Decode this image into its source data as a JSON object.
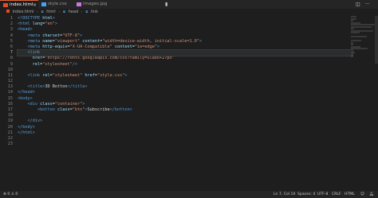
{
  "tabs": [
    {
      "label": "index.html",
      "icon": "html-file-icon",
      "active": true
    },
    {
      "label": "style.css",
      "icon": "css-file-icon",
      "active": false
    },
    {
      "label": "images.jpg",
      "icon": "image-file-icon",
      "active": false
    }
  ],
  "tab_close_glyph": "×",
  "breadcrumb": [
    {
      "label": "index.html"
    },
    {
      "label": "html"
    },
    {
      "label": "head"
    },
    {
      "label": "link"
    }
  ],
  "breadcrumb_sep": "›",
  "line_numbers": [
    "1",
    "2",
    "3",
    "4",
    "5",
    "6",
    "7",
    "8",
    "9",
    "10",
    "11",
    "12",
    "13",
    "14",
    "15",
    "16",
    "17",
    "18",
    "19",
    "20",
    "21",
    "22",
    "23"
  ],
  "current_line": 7,
  "code_lines": [
    [
      {
        "t": "<!DOCTYPE ",
        "c": "tag"
      },
      {
        "t": "html",
        "c": "attr"
      },
      {
        "t": ">",
        "c": "tag"
      }
    ],
    [
      {
        "t": "<html ",
        "c": "tag"
      },
      {
        "t": "lang",
        "c": "attr"
      },
      {
        "t": "=",
        "c": "txt"
      },
      {
        "t": "\"en\"",
        "c": "str"
      },
      {
        "t": ">",
        "c": "tag"
      }
    ],
    [
      {
        "t": "<head>",
        "c": "tag"
      }
    ],
    [
      {
        "t": "    "
      },
      {
        "t": "<meta ",
        "c": "tag"
      },
      {
        "t": "charset",
        "c": "attr"
      },
      {
        "t": "=",
        "c": "txt"
      },
      {
        "t": "\"UTF-8\"",
        "c": "str"
      },
      {
        "t": ">",
        "c": "tag"
      }
    ],
    [
      {
        "t": "    "
      },
      {
        "t": "<meta ",
        "c": "tag"
      },
      {
        "t": "name",
        "c": "attr"
      },
      {
        "t": "=",
        "c": "txt"
      },
      {
        "t": "\"viewport\"",
        "c": "str"
      },
      {
        "t": " "
      },
      {
        "t": "content",
        "c": "attr"
      },
      {
        "t": "=",
        "c": "txt"
      },
      {
        "t": "\"width=device-width, initial-scale=1.0\"",
        "c": "str"
      },
      {
        "t": ">",
        "c": "tag"
      }
    ],
    [
      {
        "t": "    "
      },
      {
        "t": "<meta ",
        "c": "tag"
      },
      {
        "t": "http-equiv",
        "c": "attr"
      },
      {
        "t": "=",
        "c": "txt"
      },
      {
        "t": "\"X-UA-Compatible\"",
        "c": "str"
      },
      {
        "t": " "
      },
      {
        "t": "content",
        "c": "attr"
      },
      {
        "t": "=",
        "c": "txt"
      },
      {
        "t": "\"ie=edge\"",
        "c": "str"
      },
      {
        "t": ">",
        "c": "tag"
      }
    ],
    [
      {
        "t": "    "
      },
      {
        "t": "<link",
        "c": "tag"
      }
    ],
    [
      {
        "t": "      "
      },
      {
        "t": "href",
        "c": "attr"
      },
      {
        "t": "=",
        "c": "txt"
      },
      {
        "t": "\"https://fonts.googleapis.com/css?family=Slabo+27px\"",
        "c": "str"
      }
    ],
    [
      {
        "t": "      "
      },
      {
        "t": "rel",
        "c": "attr"
      },
      {
        "t": "=",
        "c": "txt"
      },
      {
        "t": "\"stylesheet\"",
        "c": "str"
      },
      {
        "t": "/>",
        "c": "tag"
      }
    ],
    [],
    [
      {
        "t": "    "
      },
      {
        "t": "<link ",
        "c": "tag"
      },
      {
        "t": "rel",
        "c": "attr"
      },
      {
        "t": "=",
        "c": "txt"
      },
      {
        "t": "\"stylesheet\"",
        "c": "str"
      },
      {
        "t": " "
      },
      {
        "t": "href",
        "c": "attr"
      },
      {
        "t": "=",
        "c": "txt"
      },
      {
        "t": "\"style.css\"",
        "c": "str"
      },
      {
        "t": ">",
        "c": "tag"
      }
    ],
    [],
    [
      {
        "t": "    "
      },
      {
        "t": "<title>",
        "c": "tag"
      },
      {
        "t": "3D Botton",
        "c": "txt"
      },
      {
        "t": "</title>",
        "c": "tag"
      }
    ],
    [
      {
        "t": "</head>",
        "c": "tag"
      }
    ],
    [
      {
        "t": "<body>",
        "c": "tag"
      }
    ],
    [
      {
        "t": "    "
      },
      {
        "t": "<div ",
        "c": "tag"
      },
      {
        "t": "class",
        "c": "attr"
      },
      {
        "t": "=",
        "c": "txt"
      },
      {
        "t": "\"container\"",
        "c": "str"
      },
      {
        "t": ">",
        "c": "tag"
      }
    ],
    [
      {
        "t": "        "
      },
      {
        "t": "<botton ",
        "c": "tag"
      },
      {
        "t": "class",
        "c": "attr"
      },
      {
        "t": "=",
        "c": "txt"
      },
      {
        "t": "\"btn\"",
        "c": "str"
      },
      {
        "t": ">",
        "c": "tag"
      },
      {
        "t": "Subscribe",
        "c": "txt"
      },
      {
        "t": "</botton>",
        "c": "tag"
      }
    ],
    [],
    [
      {
        "t": "    "
      },
      {
        "t": "</div>",
        "c": "tag"
      }
    ],
    [
      {
        "t": "</body>",
        "c": "tag"
      }
    ],
    [
      {
        "t": "</html>",
        "c": "tag"
      }
    ],
    [],
    []
  ],
  "status": {
    "left_glyph": "⊗",
    "errors": "0",
    "warnings_glyph": "⚠",
    "warnings": "0",
    "position": "Ln 7, Col 10",
    "spaces": "Spaces: 4",
    "encoding": "UTF-8",
    "eol": "CRLF",
    "language": "HTML"
  },
  "colors": {
    "editor_bg": "#1e1e1e",
    "tag": "#569cd6",
    "attr": "#9cdcfe",
    "string": "#ce9178",
    "active_tab_accent": "#e0653a"
  }
}
